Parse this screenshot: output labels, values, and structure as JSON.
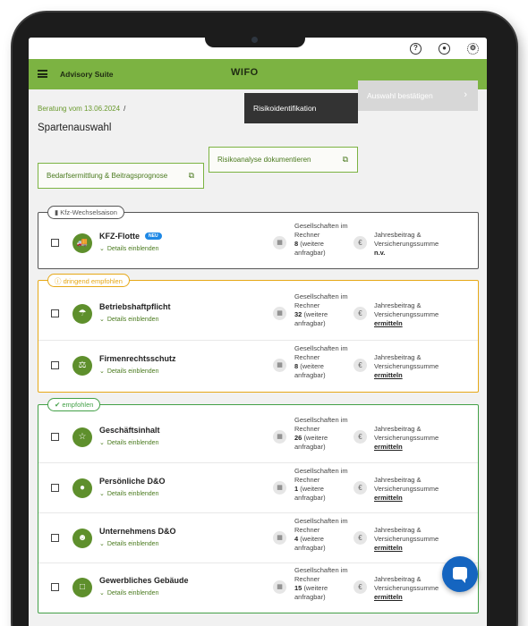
{
  "header": {
    "app_name": "Advisory Suite",
    "logo": "WIFO",
    "icons": [
      "help-icon",
      "user-icon",
      "settings-icon"
    ]
  },
  "breadcrumb": {
    "link": "Beratung vom 13.06.2024",
    "separator": "/"
  },
  "page_title": "Spartenauswahl",
  "steps": [
    {
      "label": "Risikoidentifikation",
      "active": true
    },
    {
      "label": "Auswahl bestätigen",
      "active": false
    }
  ],
  "actions": {
    "bedarf": "Bedarfsermittlung & Beitragsprognose",
    "risiko": "Risikoanalyse dokumentieren"
  },
  "groups": [
    {
      "tag": "Kfz-Wechselsaison",
      "color": "#555555",
      "rows": [
        {
          "name": "KFZ-Flotte",
          "badge": "NEU",
          "details": "Details einblenden",
          "companies_label": "Gesellschaften im Rechner",
          "count": "8",
          "count_suffix": "(weitere anfragbar)",
          "fee_label": "Jahresbeitrag & Versicherungssumme",
          "fee_value": "n.v."
        }
      ]
    },
    {
      "tag": "dringend empfohlen",
      "color": "#e6a817",
      "rows": [
        {
          "name": "Betriebshaftpflicht",
          "details": "Details einblenden",
          "companies_label": "Gesellschaften im Rechner",
          "count": "32",
          "count_suffix": "(weitere anfragbar)",
          "fee_label": "Jahresbeitrag & Versicherungssumme",
          "fee_value": "ermitteln"
        },
        {
          "name": "Firmenrechtsschutz",
          "details": "Details einblenden",
          "companies_label": "Gesellschaften im Rechner",
          "count": "8",
          "count_suffix": "(weitere anfragbar)",
          "fee_label": "Jahresbeitrag & Versicherungssumme",
          "fee_value": "ermitteln"
        }
      ]
    },
    {
      "tag": "empfohlen",
      "color": "#43a047",
      "rows": [
        {
          "name": "Geschäftsinhalt",
          "details": "Details einblenden",
          "companies_label": "Gesellschaften im Rechner",
          "count": "26",
          "count_suffix": "(weitere anfragbar)",
          "fee_label": "Jahresbeitrag & Versicherungssumme",
          "fee_value": "ermitteln"
        },
        {
          "name": "Persönliche D&O",
          "details": "Details einblenden",
          "companies_label": "Gesellschaften im Rechner",
          "count": "1",
          "count_suffix": "(weitere anfragbar)",
          "fee_label": "Jahresbeitrag & Versicherungssumme",
          "fee_value": "ermitteln"
        },
        {
          "name": "Unternehmens D&O",
          "details": "Details einblenden",
          "companies_label": "Gesellschaften im Rechner",
          "count": "4",
          "count_suffix": "(weitere anfragbar)",
          "fee_label": "Jahresbeitrag & Versicherungssumme",
          "fee_value": "ermitteln"
        },
        {
          "name": "Gewerbliches Gebäude",
          "details": "Details einblenden",
          "companies_label": "Gesellschaften im Rechner",
          "count": "15",
          "count_suffix": "(weitere anfragbar)",
          "fee_label": "Jahresbeitrag & Versicherungssumme",
          "fee_value": "ermitteln"
        }
      ]
    }
  ],
  "colors": {
    "brand_green": "#7cb342",
    "dark": "#333333",
    "chat": "#1565c0"
  }
}
